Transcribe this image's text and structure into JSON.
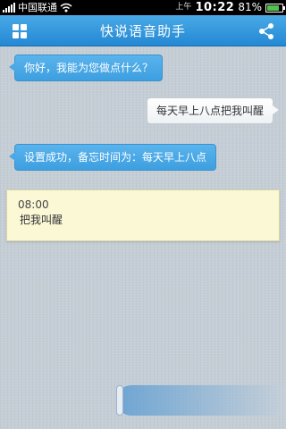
{
  "status_bar": {
    "carrier": "中国联通",
    "ampm": "上午",
    "time": "10:22",
    "battery": "81%",
    "battery_level": 0.81,
    "icons": [
      "signal-icon",
      "wifi-icon",
      "battery-icon"
    ]
  },
  "header": {
    "title": "快说语音助手",
    "left_icon": "grid-menu-icon",
    "right_icon": "share-icon"
  },
  "messages": [
    {
      "from": "assistant",
      "text": "你好，我能为您做点什么？"
    },
    {
      "from": "user",
      "text": "每天早上八点把我叫醒"
    },
    {
      "from": "assistant",
      "text": "设置成功，备忘时间为：每天早上八点"
    }
  ],
  "reminder": {
    "time": "08:00",
    "text": "把我叫醒"
  },
  "colors": {
    "accent": "#2f95dc",
    "card": "#fbf8d6",
    "background": "#c5ced6"
  }
}
